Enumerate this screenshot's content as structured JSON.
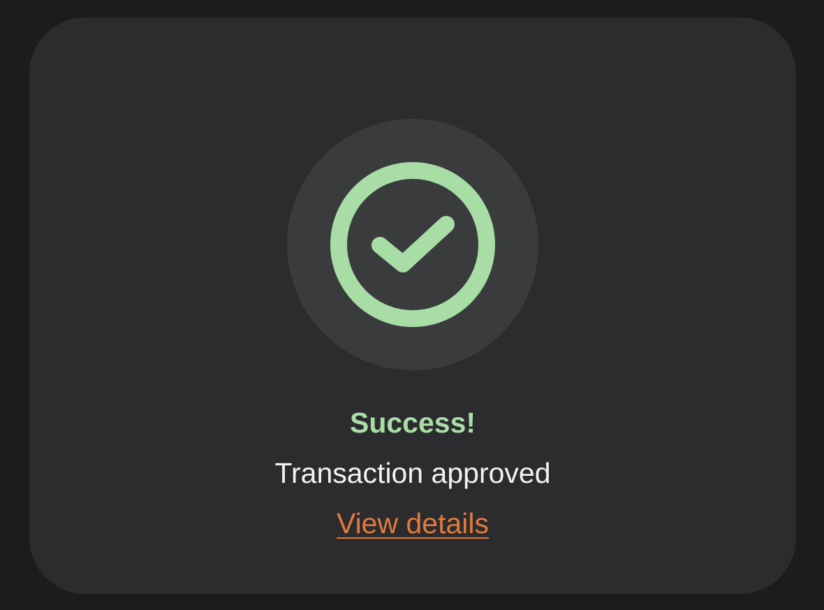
{
  "status": {
    "title": "Success!",
    "message": "Transaction approved",
    "link_label": "View details"
  },
  "icons": {
    "status_icon": "check-circle-icon"
  },
  "colors": {
    "page_background": "#1c1c1c",
    "card_background": "#2c2c2e",
    "icon_halo": "#3a3b3d",
    "success_green": "#a8dea5",
    "message_text": "#f2f2f2",
    "link_orange": "#e07b3c"
  }
}
